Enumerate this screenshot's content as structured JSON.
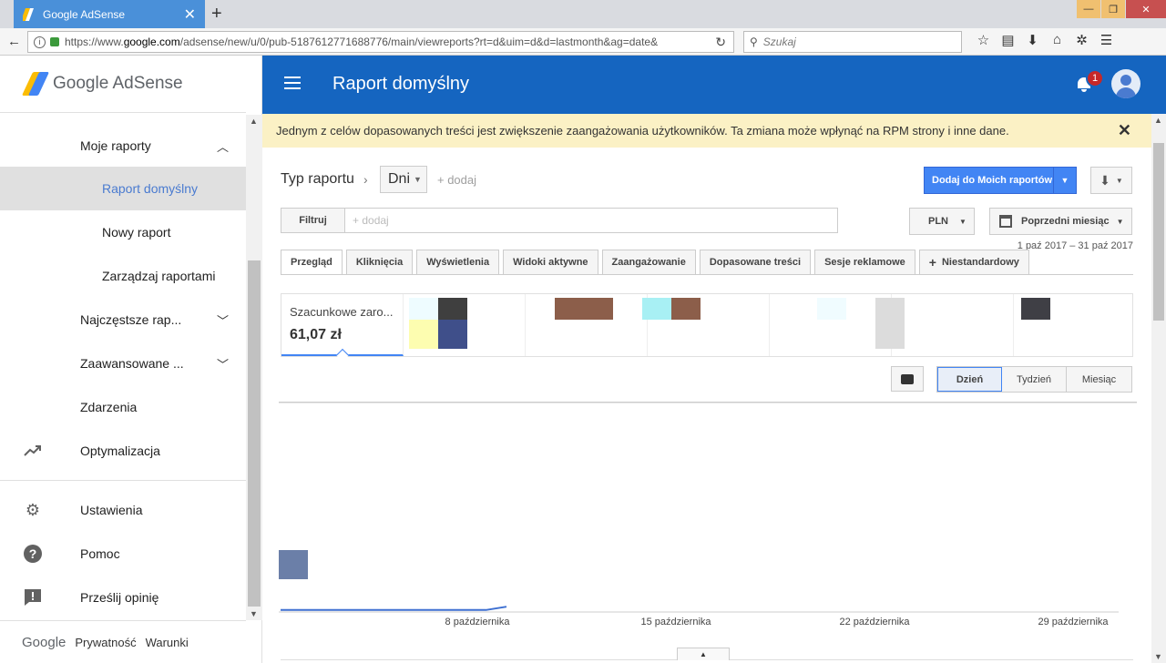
{
  "browser": {
    "tab_title": "Google AdSense",
    "new_tab": "+",
    "url_prefix": "https://www.",
    "url_host": "google.com",
    "url_path": "/adsense/new/u/0/pub-5187612771688776/main/viewreports?rt=d&uim=d&d=lastmonth&ag=date&",
    "search_placeholder": "Szukaj"
  },
  "sidebar": {
    "brand": "Google AdSense",
    "items": [
      {
        "label": "Moje raporty"
      },
      {
        "label": "Raport domyślny"
      },
      {
        "label": "Nowy raport"
      },
      {
        "label": "Zarządzaj raportami"
      },
      {
        "label": "Najczęstsze rap..."
      },
      {
        "label": "Zaawansowane ..."
      },
      {
        "label": "Zdarzenia"
      },
      {
        "label": "Optymalizacja"
      },
      {
        "label": "Ustawienia"
      },
      {
        "label": "Pomoc"
      },
      {
        "label": "Prześlij opinię"
      }
    ],
    "footer": {
      "google": "Google",
      "privacy": "Prywatność",
      "terms": "Warunki"
    }
  },
  "appbar": {
    "title": "Raport domyślny",
    "notifications": "1"
  },
  "banner": {
    "text": "Jednym z celów dopasowanych treści jest zwiększenie zaangażowania użytkowników. Ta zmiana może wpłynąć na RPM strony i inne dane."
  },
  "report": {
    "type_label": "Typ raportu",
    "dimension": "Dni",
    "add": "+ dodaj",
    "add_to_my_reports": "Dodaj do Moich raportów",
    "filter_label": "Filtruj",
    "filter_placeholder": "+ dodaj",
    "currency": "PLN",
    "period": "Poprzedni miesiąc",
    "date_range": "1 paź 2017 – 31 paź 2017",
    "tabs": [
      "Przegląd",
      "Kliknięcia",
      "Wyświetlenia",
      "Widoki aktywne",
      "Zaangażowanie",
      "Dopasowane treści",
      "Sesje reklamowe",
      "Niestandardowy"
    ],
    "metric_label": "Szacunkowe zaro...",
    "metric_value": "61,07 zł",
    "granularity": [
      "Dzień",
      "Tydzień",
      "Miesiąc"
    ]
  },
  "chart_data": {
    "type": "line",
    "x_ticks": [
      "8 października",
      "15 października",
      "22 października",
      "29 października"
    ],
    "series": [
      {
        "values": [
          0.6,
          0.6,
          0.6,
          0.6,
          0.6,
          0.6,
          0.6,
          0.6,
          0.6,
          0.6,
          0.6,
          2.4
        ]
      }
    ]
  }
}
